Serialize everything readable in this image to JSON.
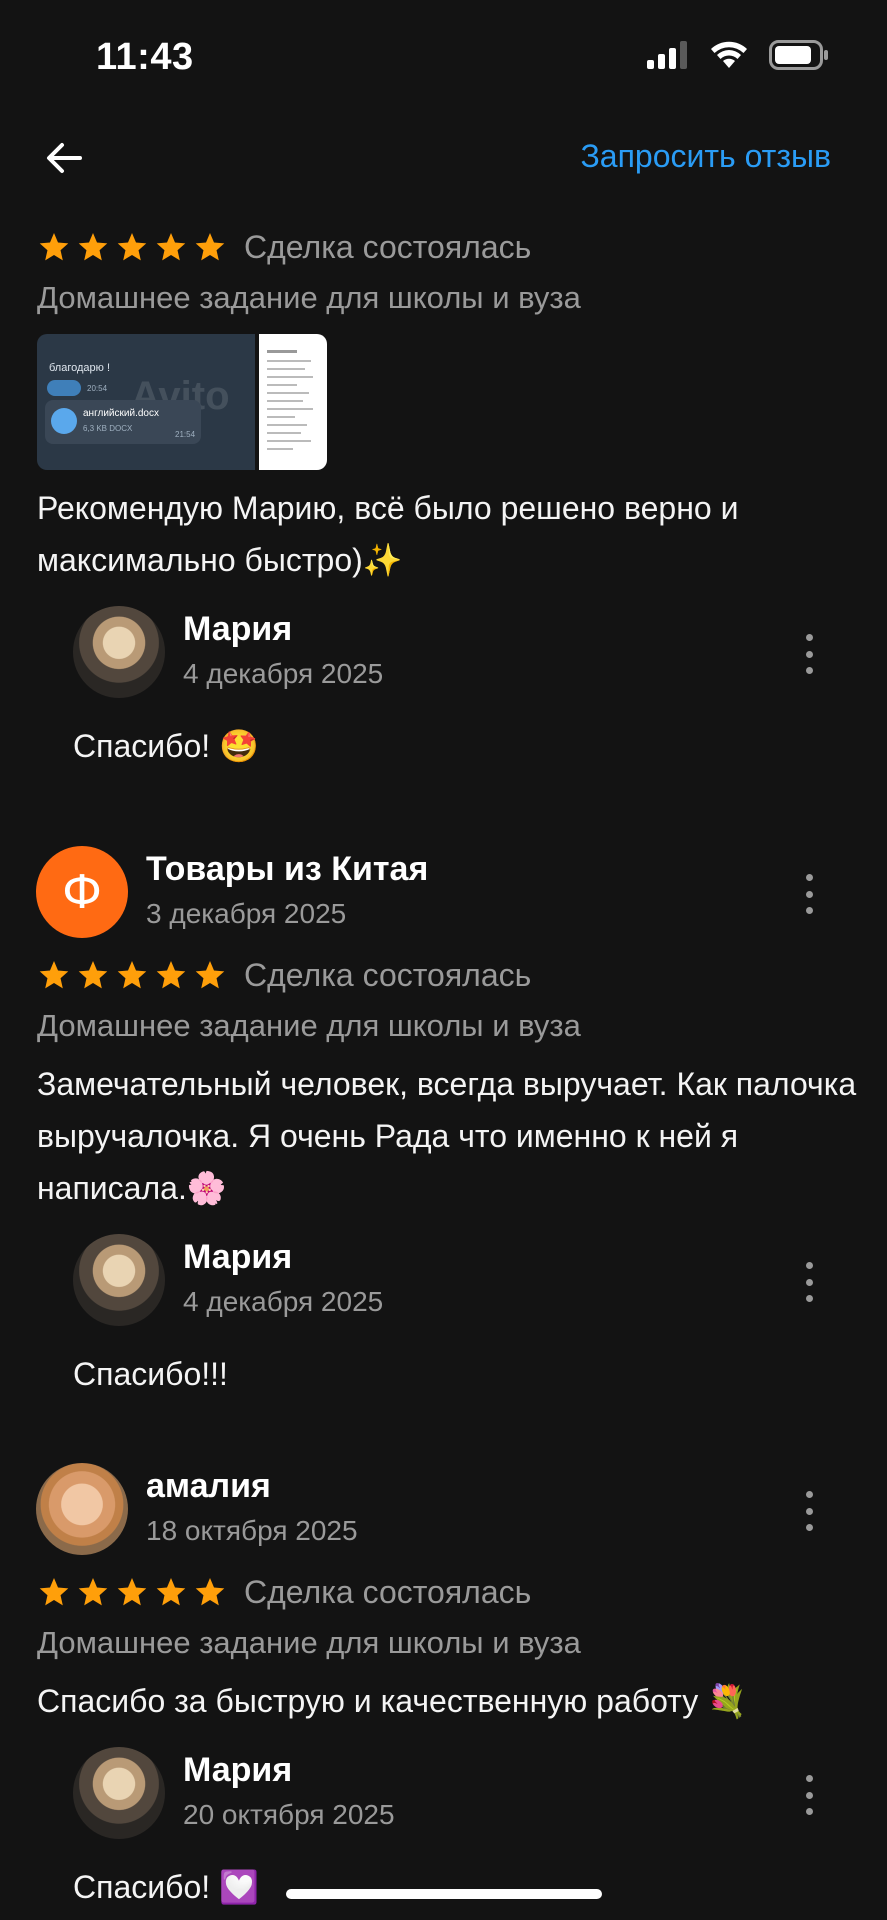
{
  "status_bar": {
    "time": "11:43"
  },
  "nav": {
    "action_label": "Запросить отзыв"
  },
  "reviews": [
    {
      "rating": 5,
      "status": "Сделка состоялась",
      "category": "Домашнее задание для школы и вуза",
      "attachments": {
        "thumb1_line1": "благодарю !",
        "thumb1_time1": "20:54",
        "thumb1_file": "английский.docx",
        "thumb1_size": "6,3 KB DOCX",
        "thumb1_time2": "21:54",
        "thumb1_watermark": "Avito"
      },
      "text": "Рекомендую Марию, всё было решено верно и максимально быстро)✨",
      "reply": {
        "name": "Мария",
        "date": "4 декабря 2025",
        "text": "Спасибо! 🤩"
      }
    },
    {
      "author": {
        "avatar_letter": "Ф",
        "name": "Товары из Китая",
        "date": "3 декабря 2025"
      },
      "rating": 5,
      "status": "Сделка состоялась",
      "category": "Домашнее задание для школы и вуза",
      "text": "Замечательный человек, всегда выручает. Как палочка выручалочка. Я очень Рада что именно к ней я написала.🌸",
      "reply": {
        "name": "Мария",
        "date": "4 декабря 2025",
        "text": "Спасибо!!!"
      }
    },
    {
      "author": {
        "name": "амалия",
        "date": "18 октября 2025"
      },
      "rating": 5,
      "status": "Сделка состоялась",
      "category": "Домашнее задание для школы и вуза",
      "text": "Спасибо за быструю и качественную работу 💐",
      "reply": {
        "name": "Мария",
        "date": "20 октября 2025",
        "text": "Спасибо! 💟"
      }
    }
  ],
  "colors": {
    "accent": "#2a9cf5",
    "star": "#ff9f0a",
    "avatar_orange": "#ff6a13",
    "background": "#131313"
  }
}
